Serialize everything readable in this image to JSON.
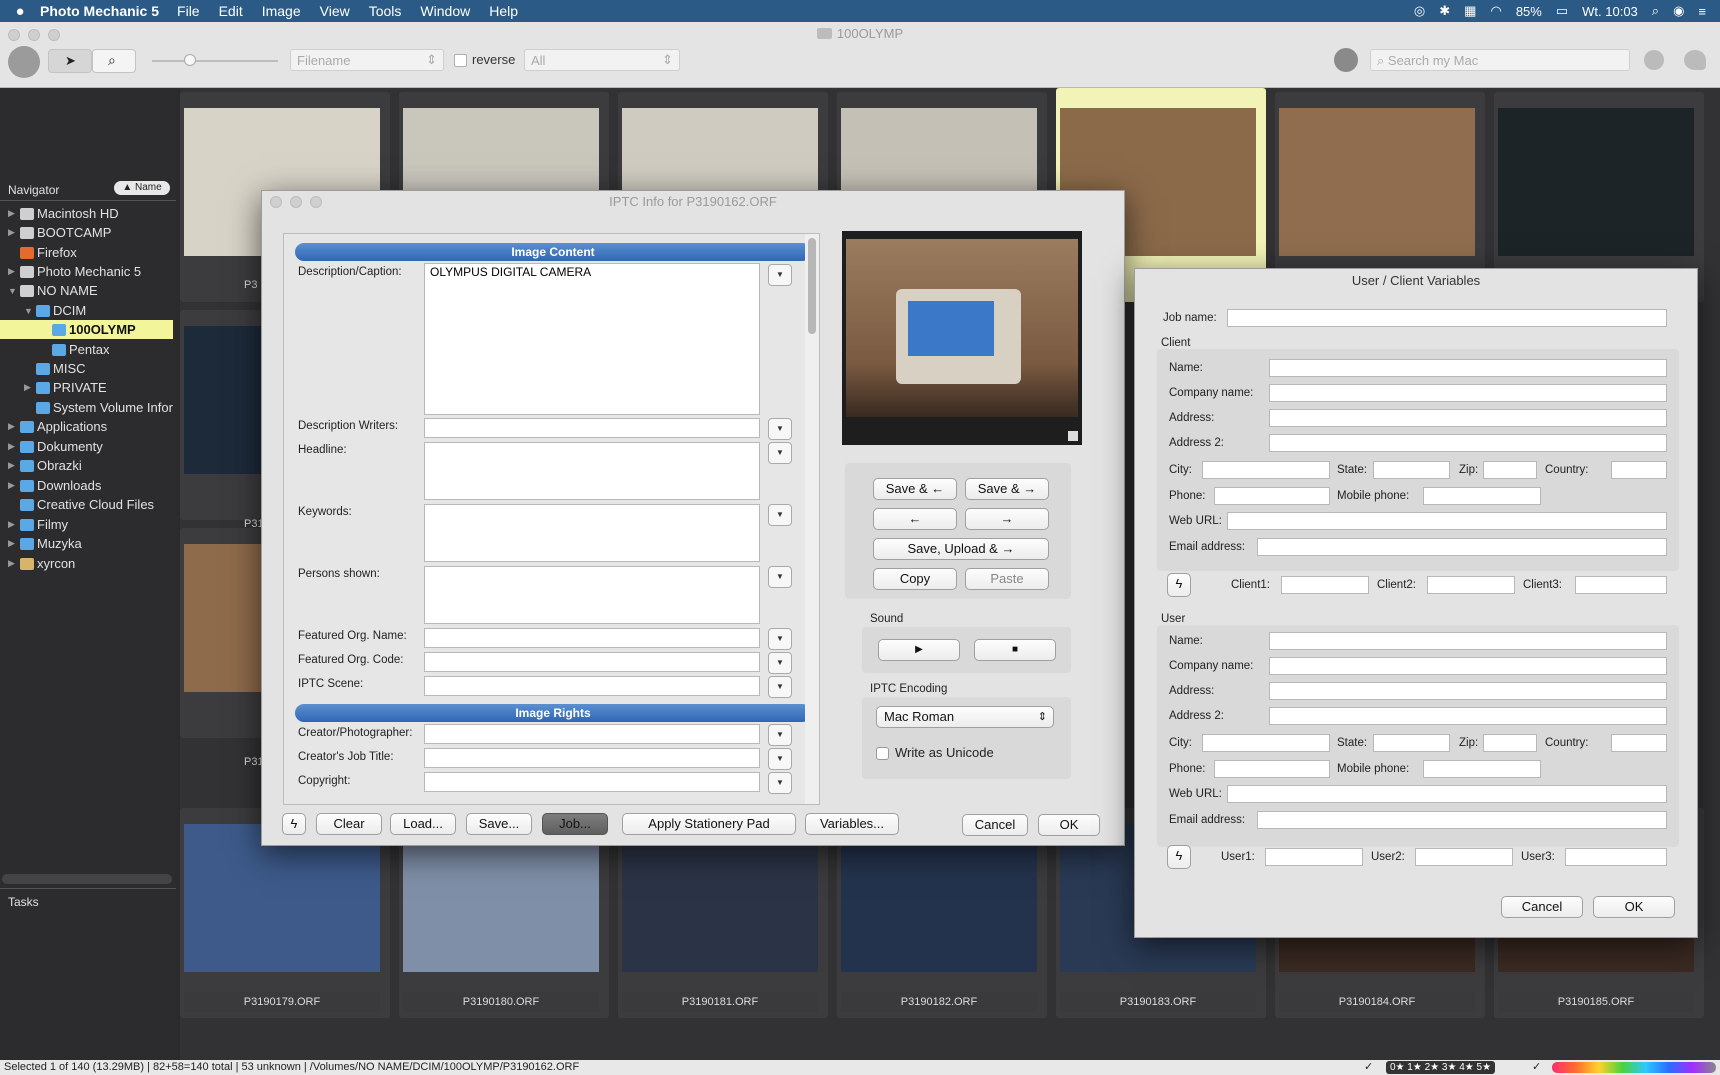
{
  "menubar": {
    "app_name": "Photo Mechanic 5",
    "items": [
      "File",
      "Edit",
      "Image",
      "View",
      "Tools",
      "Window",
      "Help"
    ],
    "battery": "85%",
    "clock": "Wt. 10:03"
  },
  "window": {
    "title": "100OLYMP",
    "filename_sort": "Filename",
    "reverse_label": "reverse",
    "filter": "All",
    "search_placeholder": "Search my Mac"
  },
  "navigator": {
    "title": "Navigator",
    "sort_button": "▲ Name",
    "items": [
      {
        "label": "Macintosh HD",
        "icon": "disk"
      },
      {
        "label": "BOOTCAMP",
        "icon": "disk"
      },
      {
        "label": "Firefox",
        "icon": "app"
      },
      {
        "label": "Photo Mechanic 5",
        "icon": "disk"
      },
      {
        "label": "NO NAME",
        "icon": "sdcard"
      },
      {
        "label": "DCIM",
        "icon": "folder"
      },
      {
        "label": "100OLYMP",
        "icon": "folder"
      },
      {
        "label": "Pentax",
        "icon": "folder"
      },
      {
        "label": "MISC",
        "icon": "folder"
      },
      {
        "label": "PRIVATE",
        "icon": "folder"
      },
      {
        "label": "System Volume Infor",
        "icon": "folder"
      },
      {
        "label": "Applications",
        "icon": "folder"
      },
      {
        "label": "Dokumenty",
        "icon": "folder"
      },
      {
        "label": "Obrazki",
        "icon": "folder"
      },
      {
        "label": "Downloads",
        "icon": "folder"
      },
      {
        "label": "Creative Cloud Files",
        "icon": "folder"
      },
      {
        "label": "Filmy",
        "icon": "folder"
      },
      {
        "label": "Muzyka",
        "icon": "folder"
      },
      {
        "label": "xyrcon",
        "icon": "home"
      }
    ],
    "tasks_title": "Tasks"
  },
  "grid": {
    "row_labels_top": [
      "P3",
      "P31",
      "P31"
    ],
    "bottom_labels": [
      "P3190179.ORF",
      "P3190180.ORF",
      "P3190181.ORF",
      "P3190182.ORF",
      "P3190183.ORF",
      "P3190184.ORF",
      "P3190185.ORF"
    ]
  },
  "status": "Selected 1 of 140 (13.29MB) | 82+58=140 total | 53 unknown | /Volumes/NO NAME/DCIM/100OLYMP/P3190162.ORF",
  "status_stars": "0★ 1★ 2★ 3★ 4★ 5★",
  "iptc": {
    "title": "IPTC Info for P3190162.ORF",
    "section_content": "Image Content",
    "section_rights": "Image Rights",
    "fields": {
      "description": {
        "label": "Description/Caption:",
        "value": "OLYMPUS DIGITAL CAMERA"
      },
      "desc_writers": {
        "label": "Description Writers:",
        "value": ""
      },
      "headline": {
        "label": "Headline:",
        "value": ""
      },
      "keywords": {
        "label": "Keywords:",
        "value": ""
      },
      "persons": {
        "label": "Persons shown:",
        "value": ""
      },
      "org_name": {
        "label": "Featured Org. Name:",
        "value": ""
      },
      "org_code": {
        "label": "Featured Org. Code:",
        "value": ""
      },
      "scene": {
        "label": "IPTC Scene:",
        "value": ""
      },
      "creator": {
        "label": "Creator/Photographer:",
        "value": ""
      },
      "job_title": {
        "label": "Creator's Job Title:",
        "value": ""
      },
      "copyright": {
        "label": "Copyright:",
        "value": ""
      }
    },
    "nav_buttons": {
      "save_prev": "Save & ←",
      "save_next": "Save & →",
      "prev": "←",
      "next": "→",
      "save_upload": "Save, Upload & →",
      "copy": "Copy",
      "paste": "Paste"
    },
    "sound_label": "Sound",
    "encoding_label": "IPTC Encoding",
    "encoding_value": "Mac Roman",
    "unicode_label": "Write as Unicode",
    "bottom_buttons": {
      "clear": "Clear",
      "load": "Load...",
      "save": "Save...",
      "job": "Job...",
      "stationery": "Apply Stationery Pad",
      "variables": "Variables...",
      "cancel": "Cancel",
      "ok": "OK"
    }
  },
  "vars": {
    "title": "User / Client Variables",
    "job_name": "Job name:",
    "client_title": "Client",
    "user_title": "User",
    "labels": {
      "name": "Name:",
      "company": "Company name:",
      "address": "Address:",
      "address2": "Address 2:",
      "city": "City:",
      "state": "State:",
      "zip": "Zip:",
      "country": "Country:",
      "phone": "Phone:",
      "mobile": "Mobile phone:",
      "web": "Web URL:",
      "email": "Email address:",
      "client1": "Client1:",
      "client2": "Client2:",
      "client3": "Client3:",
      "user1": "User1:",
      "user2": "User2:",
      "user3": "User3:"
    },
    "cancel": "Cancel",
    "ok": "OK"
  }
}
